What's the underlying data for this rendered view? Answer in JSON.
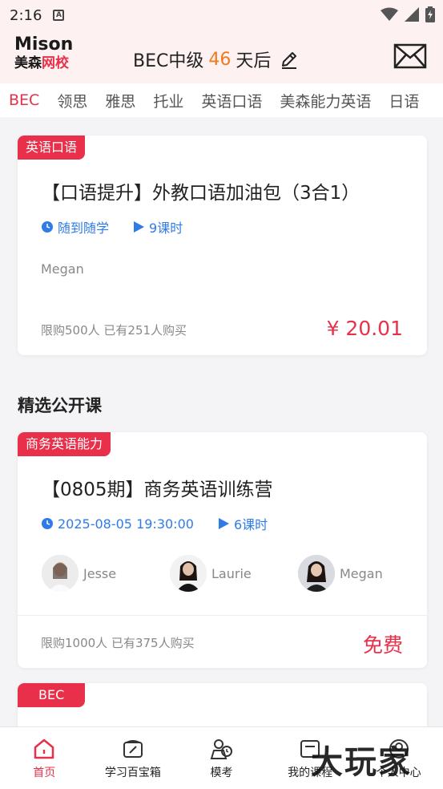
{
  "status_bar": {
    "time": "2:16",
    "a_icon": "A"
  },
  "header": {
    "logo_top": "Mison",
    "logo_bottom_left": "美森",
    "logo_bottom_right": "网校",
    "countdown_prefix": "BEC中级",
    "countdown_num": "46",
    "countdown_suffix": "天后"
  },
  "tabs": [
    "BEC",
    "领思",
    "雅思",
    "托业",
    "英语口语",
    "美森能力英语",
    "日语"
  ],
  "card1": {
    "tag": "英语口语",
    "title": "【口语提升】外教口语加油包（3合1）",
    "schedule": "随到随学",
    "lessons": "9课时",
    "teacher": "Megan",
    "buy_info": "限购500人 已有251人购买",
    "price": "¥ 20.01"
  },
  "section_title": "精选公开课",
  "card2": {
    "tag": "商务英语能力",
    "title": "【0805期】商务英语训练营",
    "schedule": "2025-08-05 19:30:00",
    "lessons": "6课时",
    "teachers": [
      "Jesse",
      "Laurie",
      "Megan"
    ],
    "buy_info": "限购1000人 已有375人购买",
    "price": "免费"
  },
  "card3": {
    "tag": "BEC"
  },
  "bottom_nav": [
    {
      "label": "首页",
      "icon": "home-icon"
    },
    {
      "label": "学习百宝箱",
      "icon": "toolbox-icon"
    },
    {
      "label": "模考",
      "icon": "exam-icon"
    },
    {
      "label": "我的课程",
      "icon": "courses-icon"
    },
    {
      "label": "个人中心",
      "icon": "profile-icon"
    }
  ],
  "watermark": "大玩家",
  "colors": {
    "accent": "#e8304a",
    "blue": "#2f7be8",
    "orange": "#f07a1d"
  }
}
